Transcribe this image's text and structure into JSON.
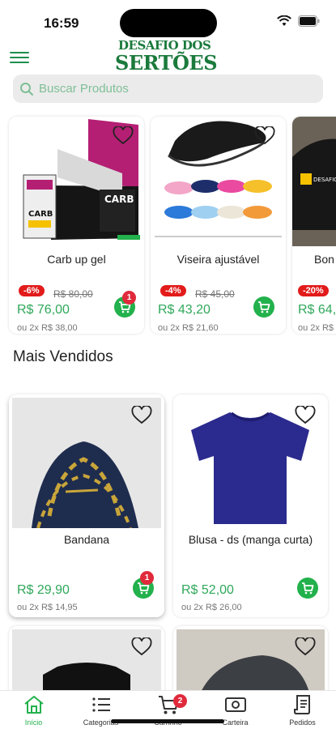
{
  "status": {
    "time": "16:59"
  },
  "header": {
    "logo_line1": "DESAFIO DOS",
    "logo_line2": "SERTÕES"
  },
  "search": {
    "placeholder": "Buscar Produtos"
  },
  "featured": [
    {
      "name": "Carb up gel",
      "discount": "-6%",
      "old_price": "R$ 80,00",
      "price": "R$ 76,00",
      "installments": "ou 2x R$ 38,00",
      "cart_count": "1"
    },
    {
      "name": "Viseira ajustável",
      "discount": "-4%",
      "old_price": "R$ 45,00",
      "price": "R$ 43,20",
      "installments": "ou 2x R$ 21,60",
      "cart_count": ""
    },
    {
      "name": "Bon",
      "discount": "-20%",
      "old_price": "",
      "price": "R$ 64,",
      "installments": "ou 2x R$",
      "cart_count": ""
    }
  ],
  "section": {
    "title": "Mais Vendidos"
  },
  "best_sellers": [
    {
      "name": "Bandana",
      "price": "R$ 29,90",
      "installments": "ou 2x R$ 14,95",
      "cart_count": "1"
    },
    {
      "name": "Blusa - ds (manga curta)",
      "price": "R$ 52,00",
      "installments": "ou 2x R$ 26,00",
      "cart_count": ""
    }
  ],
  "nav": {
    "items": [
      {
        "label": "Início",
        "icon": "home-icon",
        "active": true
      },
      {
        "label": "Categorias",
        "icon": "list-icon"
      },
      {
        "label": "Carrinho",
        "icon": "cart-icon",
        "badge": "2"
      },
      {
        "label": "Carteira",
        "icon": "wallet-icon"
      },
      {
        "label": "Pedidos",
        "icon": "receipt-icon"
      }
    ]
  },
  "colors": {
    "accent": "#22b14c",
    "price": "#2fa85a",
    "discount": "#e21b1b",
    "badge": "#e02a3c"
  }
}
